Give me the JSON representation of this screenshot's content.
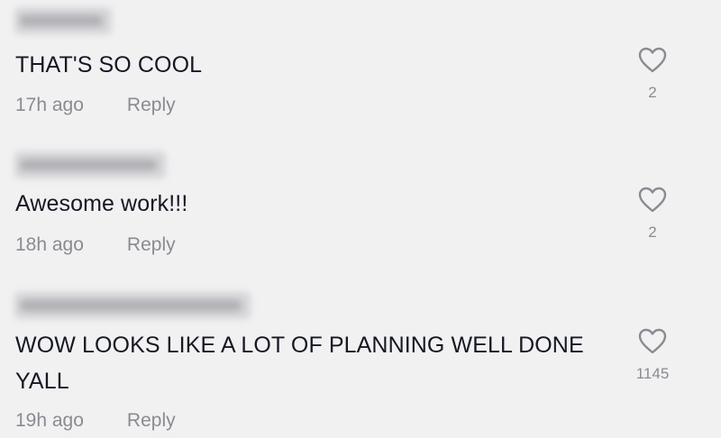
{
  "comments": [
    {
      "username": "",
      "text": "THAT'S SO COOL",
      "time": "17h ago",
      "reply_label": "Reply",
      "likes": "2"
    },
    {
      "username": "",
      "text": "Awesome work!!!",
      "time": "18h ago",
      "reply_label": "Reply",
      "likes": "2"
    },
    {
      "username": "",
      "text": "WOW LOOKS LIKE A LOT OF PLANNING WELL DONE YALL",
      "time": "19h ago",
      "reply_label": "Reply",
      "likes": "1145"
    }
  ],
  "colors": {
    "background": "#f1f1f2",
    "text": "#161823",
    "secondary": "#8a8b91"
  }
}
